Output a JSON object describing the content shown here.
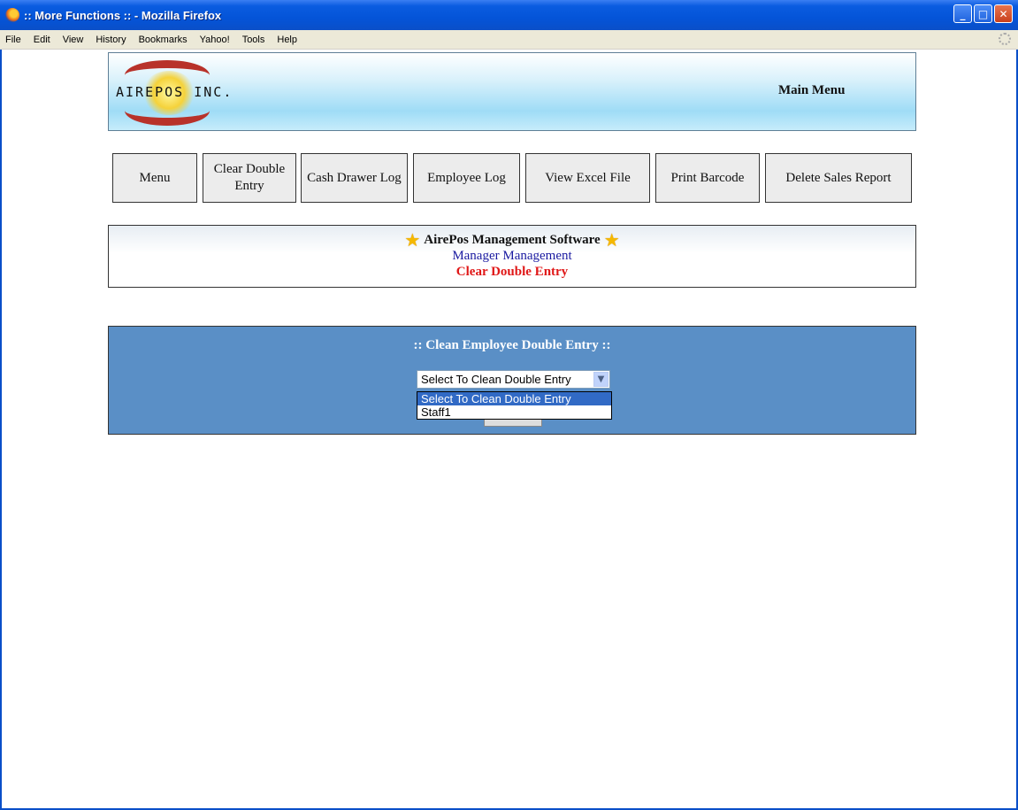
{
  "window": {
    "title": ":: More Functions :: - Mozilla Firefox",
    "minimize": "_",
    "maximize": "□",
    "close": "✕"
  },
  "menubar": {
    "items": [
      "File",
      "Edit",
      "View",
      "History",
      "Bookmarks",
      "Yahoo!",
      "Tools",
      "Help"
    ]
  },
  "banner": {
    "logo_text": "AIREPOS INC.",
    "main_menu": "Main Menu"
  },
  "nav": {
    "buttons": [
      "Menu",
      "Clear Double Entry",
      "Cash Drawer Log",
      "Employee Log",
      "View Excel File",
      "Print Barcode",
      "Delete Sales Report"
    ]
  },
  "info": {
    "title": "AirePos Management Software",
    "subtitle": "Manager Management",
    "current_page": "Clear Double Entry",
    "star_icon": "★"
  },
  "panel": {
    "title": ":: Clean Employee Double Entry ::",
    "select_value": "Select To Clean Double Entry",
    "select_arrow": "▼",
    "options": [
      "Select To Clean Double Entry",
      "Staff1"
    ],
    "selected_index": 0
  },
  "colors": {
    "panel_bg": "#5a8fc6",
    "link_blue": "#1a1aa0",
    "accent_red": "#e01818",
    "titlebar_blue": "#0454d8"
  }
}
